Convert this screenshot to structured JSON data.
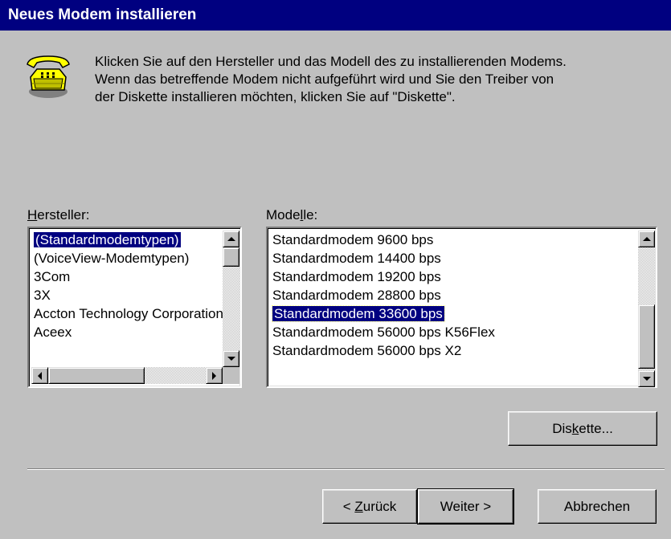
{
  "window": {
    "title": "Neues Modem installieren"
  },
  "intro": {
    "lines": [
      "Klicken Sie auf den Hersteller und das Modell des zu installierenden Modems.",
      "Wenn das betreffende Modem nicht aufgeführt wird und Sie den Treiber von",
      "der Diskette installieren möchten, klicken Sie auf \"Diskette\"."
    ]
  },
  "manufacturers": {
    "label_access": "H",
    "label_rest": "ersteller:",
    "items": [
      "(Standardmodemtypen)",
      "(VoiceView-Modemtypen)",
      "3Com",
      "3X",
      "Accton Technology Corporation",
      "Aceex"
    ],
    "selected": "(Standardmodemtypen)"
  },
  "models": {
    "label_pre": "Mode",
    "label_access": "l",
    "label_post": "le:",
    "items": [
      "Standardmodem  9600 bps",
      "Standardmodem 14400 bps",
      "Standardmodem 19200 bps",
      "Standardmodem 28800 bps",
      "Standardmodem 33600 bps",
      "Standardmodem 56000 bps K56Flex",
      "Standardmodem 56000 bps X2"
    ],
    "selected": "Standardmodem 33600 bps"
  },
  "buttons": {
    "disk_pre": "Dis",
    "disk_access": "k",
    "disk_post": "ette...",
    "back_pre": "< ",
    "back_access": "Z",
    "back_post": "urück",
    "next": "Weiter >",
    "cancel": "Abbrechen"
  },
  "icons": {
    "phone": "telephone-icon",
    "up": "scroll-up-arrow-icon",
    "down": "scroll-down-arrow-icon",
    "left": "scroll-left-arrow-icon",
    "right": "scroll-right-arrow-icon"
  },
  "colors": {
    "titlebar": "#000080",
    "face": "#c0c0c0",
    "selection": "#000080"
  }
}
